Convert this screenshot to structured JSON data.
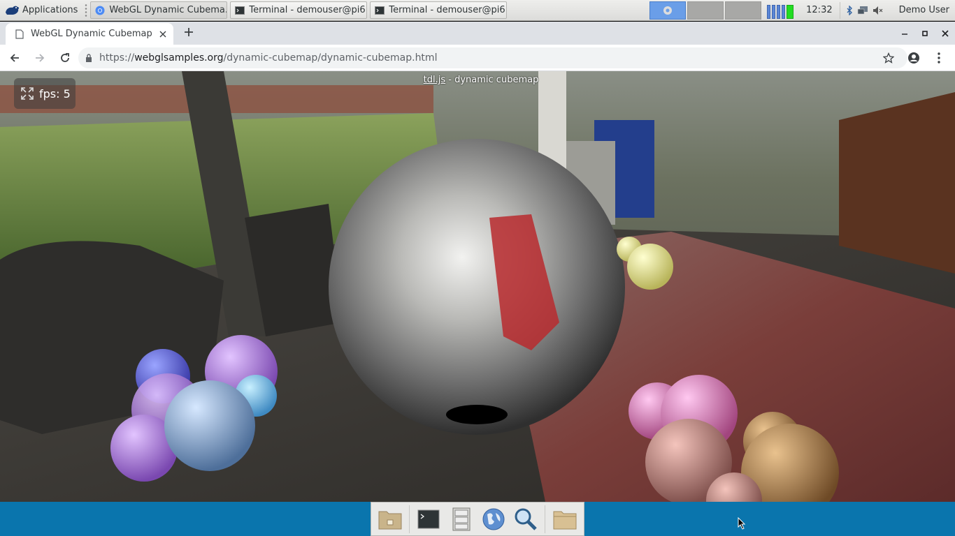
{
  "desktop": {
    "applications_label": "Applications",
    "taskbar": [
      {
        "title": "WebGL Dynamic Cubema...",
        "icon": "chrome-icon",
        "active": true
      },
      {
        "title": "Terminal - demouser@pi6...",
        "icon": "terminal-icon",
        "active": false
      },
      {
        "title": "Terminal - demouser@pi6...",
        "icon": "terminal-icon",
        "active": false
      }
    ],
    "clock": "12:32",
    "user": "Demo User"
  },
  "browser": {
    "tab_title": "WebGL Dynamic Cubemap",
    "url_scheme": "https://",
    "url_host": "webglsamples.org",
    "url_path": "/dynamic-cubemap/dynamic-cubemap.html"
  },
  "page": {
    "fps_label": "fps: 5",
    "caption_link": "tdl.js",
    "caption_text": " - dynamic cubemap"
  },
  "colors": {
    "dock_bar": "#0a75ad",
    "cpu_meter": "#5a86d6",
    "cpu_meter_active": "#22dd22"
  },
  "dock": {
    "items": [
      "home-folder-icon",
      "terminal-icon",
      "file-cabinet-icon",
      "web-browser-icon",
      "search-icon",
      "folder-icon"
    ]
  }
}
